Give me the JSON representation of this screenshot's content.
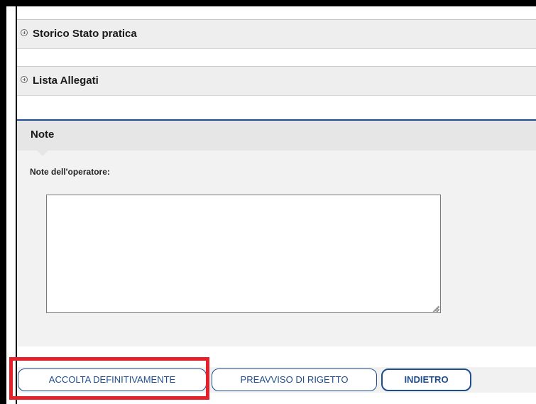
{
  "sections": {
    "storico": {
      "label": "Storico Stato pratica",
      "icon": "expand-circle-icon"
    },
    "allegati": {
      "label": "Lista Allegati",
      "icon": "expand-circle-icon"
    }
  },
  "note": {
    "title": "Note",
    "field_label": "Note dell'operatore:",
    "value": ""
  },
  "buttons": {
    "accolta": "ACCOLTA DEFINITIVAMENTE",
    "preavviso": "PREAVVISO DI RIGETTO",
    "indietro": "INDIETRO"
  },
  "colors": {
    "accent": "#1f4e8c",
    "highlight": "#e5202a",
    "panel": "#eeeeee"
  }
}
